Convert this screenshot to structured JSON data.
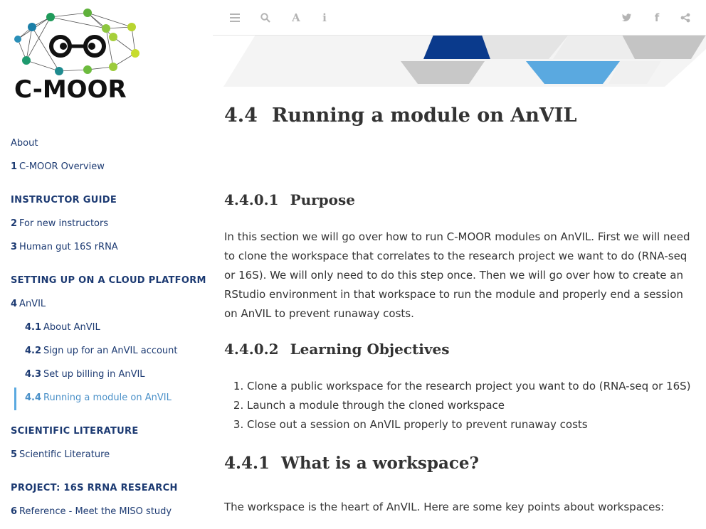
{
  "sidebar": {
    "logo_text": "C-MOOR",
    "items": [
      {
        "num": "",
        "label": "About"
      },
      {
        "num": "1",
        "label": "C-MOOR Overview"
      },
      {
        "num": "2",
        "label": "For new instructors"
      },
      {
        "num": "3",
        "label": "Human gut 16S rRNA"
      },
      {
        "num": "4",
        "label": "AnVIL"
      },
      {
        "num": "4.1",
        "label": "About AnVIL"
      },
      {
        "num": "4.2",
        "label": "Sign up for an AnVIL account"
      },
      {
        "num": "4.3",
        "label": "Set up billing in AnVIL"
      },
      {
        "num": "4.4",
        "label": "Running a module on AnVIL"
      },
      {
        "num": "5",
        "label": "Scientific Literature"
      },
      {
        "num": "6",
        "label": "Reference - Meet the MISO study"
      }
    ],
    "headers": [
      "INSTRUCTOR GUIDE",
      "SETTING UP ON A CLOUD PLATFORM",
      "SCIENTIFIC LITERATURE",
      "PROJECT: 16S RRNA RESEARCH"
    ]
  },
  "toolbar": {
    "left_icons": [
      "menu-icon",
      "search-icon",
      "font-icon",
      "info-icon"
    ],
    "right_icons": [
      "twitter-icon",
      "facebook-icon",
      "share-icon"
    ]
  },
  "content": {
    "title_num": "4.4",
    "title": "Running a module on AnVIL",
    "purpose_num": "4.4.0.1",
    "purpose_title": "Purpose",
    "purpose_text": "In this section we will go over how to run C-MOOR modules on AnVIL. First we will need to clone the workspace that correlates to the research project we want to do (RNA-seq or 16S). We will only need to do this step once. Then we will go over how to create an RStudio environment in that workspace to run the module and properly end a session on AnVIL to prevent runaway costs.",
    "objectives_num": "4.4.0.2",
    "objectives_title": "Learning Objectives",
    "objectives": [
      "Clone a public workspace for the research project you want to do (RNA-seq or 16S)",
      "Launch a module through the cloned workspace",
      "Close out a session on AnVIL properly to prevent runaway costs"
    ],
    "workspace_num": "4.4.1",
    "workspace_title": "What is a workspace?",
    "workspace_text": "The workspace is the heart of AnVIL. Here are some key points about workspaces:"
  },
  "colors": {
    "nav_text": "#1c3a72",
    "nav_active": "#4a90c8",
    "banner_dark": "#0a3a8c",
    "banner_light_blue": "#5aa9e0",
    "banner_gray": "#c8c8c8"
  }
}
